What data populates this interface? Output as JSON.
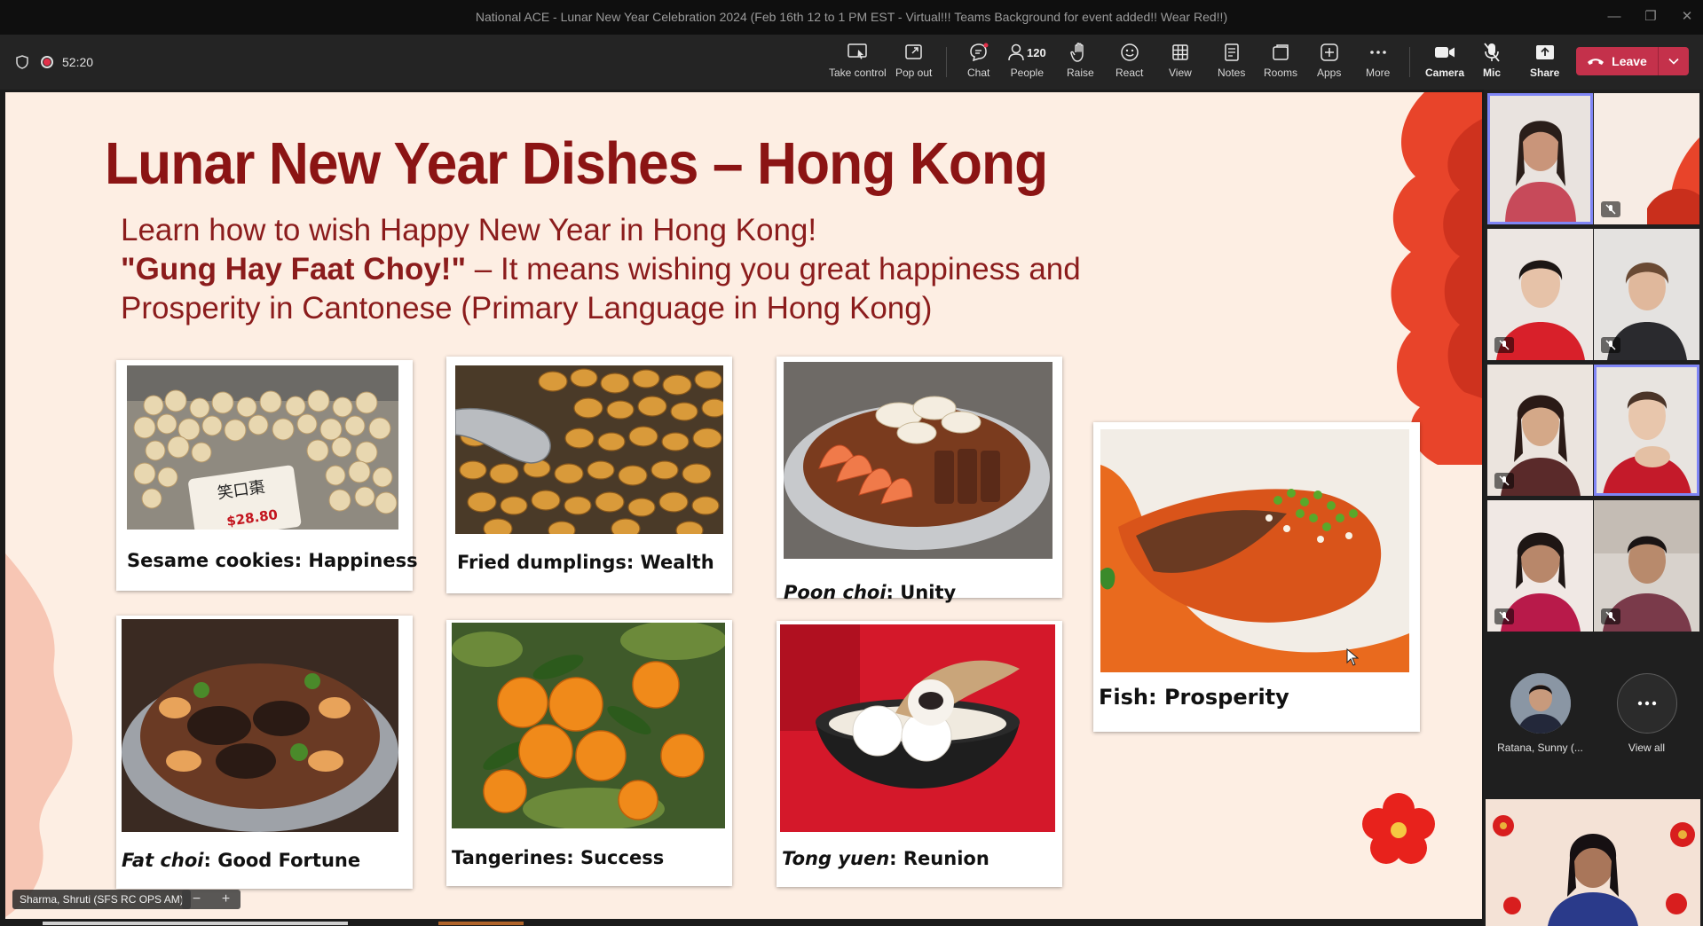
{
  "window": {
    "title": "National ACE - Lunar New Year Celebration 2024 (Feb 16th 12 to 1 PM EST - Virtual!!! Teams Background for event added!! Wear Red!!)",
    "minimize": "—",
    "restore": "❐",
    "close": "✕"
  },
  "meeting": {
    "elapsed": "52:20"
  },
  "toolbar": {
    "take_control": "Take control",
    "pop_out": "Pop out",
    "chat": "Chat",
    "people": "People",
    "people_count": "120",
    "raise": "Raise",
    "react": "React",
    "view": "View",
    "notes": "Notes",
    "rooms": "Rooms",
    "apps": "Apps",
    "more": "More",
    "camera": "Camera",
    "mic": "Mic",
    "share": "Share",
    "leave": "Leave"
  },
  "slide": {
    "title": "Lunar New Year Dishes – Hong Kong",
    "line1": "Learn how to wish Happy New Year in Hong Kong!",
    "phrase": "\"Gung Hay Faat Choy!\"",
    "line2_rest": " – It means wishing you great happiness and",
    "line3": "Prosperity in Cantonese (Primary Language in Hong Kong)",
    "price_tag": "$28.80",
    "dishes": [
      {
        "name": "Sesame cookies",
        "meaning": "Happiness"
      },
      {
        "name": "Fried dumplings",
        "meaning": "Wealth"
      },
      {
        "name": "Poon choi",
        "meaning": "Unity"
      },
      {
        "name": "Fish",
        "meaning": "Prosperity"
      },
      {
        "name": "Fat choi",
        "meaning": "Good Fortune"
      },
      {
        "name": "Tangerines",
        "meaning": "Success"
      },
      {
        "name": "Tong yuen",
        "meaning": "Reunion"
      }
    ]
  },
  "presenter": {
    "name": "Sharma, Shruti (SFS RC OPS AM)",
    "zoom_out": "−",
    "zoom_in": "+"
  },
  "gallery": {
    "overflow_name": "Ratana, Sunny (...",
    "view_all": "View all"
  }
}
